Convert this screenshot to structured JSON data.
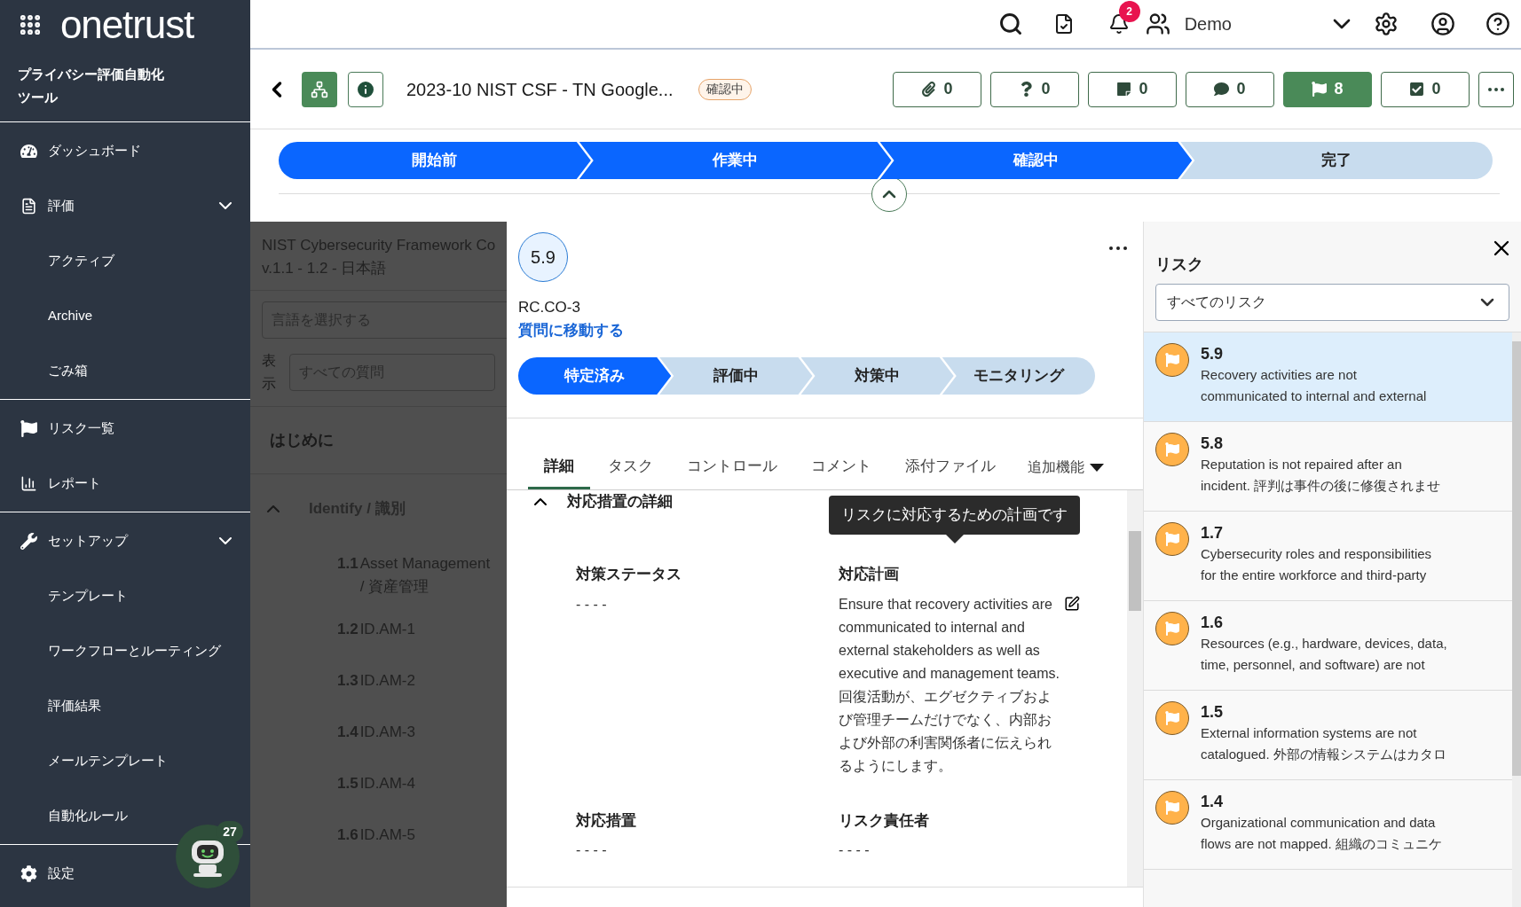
{
  "sidebar": {
    "logo": "onetrust",
    "title": "プライバシー評価自動化ツール",
    "sections": [
      {
        "items": [
          {
            "kind": "main",
            "label": "ダッシュボード"
          },
          {
            "kind": "main",
            "label": "評価",
            "expanded": true
          },
          {
            "kind": "sub",
            "label": "アクティブ"
          },
          {
            "kind": "sub",
            "label": "Archive"
          },
          {
            "kind": "sub",
            "label": "ごみ箱"
          }
        ]
      },
      {
        "items": [
          {
            "kind": "main",
            "label": "リスク一覧"
          },
          {
            "kind": "main",
            "label": "レポート"
          }
        ]
      },
      {
        "items": [
          {
            "kind": "main",
            "label": "セットアップ",
            "expanded": true
          },
          {
            "kind": "sub",
            "label": "テンプレート"
          },
          {
            "kind": "sub",
            "label": "ワークフローとルーティング"
          },
          {
            "kind": "sub",
            "label": "評価結果"
          },
          {
            "kind": "sub",
            "label": "メールテンプレート"
          },
          {
            "kind": "sub",
            "label": "自動化ルール"
          }
        ]
      },
      {
        "items": [
          {
            "kind": "main",
            "label": "設定"
          }
        ]
      }
    ],
    "bot_badge": "27"
  },
  "header": {
    "notification_count": "2",
    "user": "Demo"
  },
  "assessment": {
    "title": "2023-10 NIST CSF - TN Google...",
    "status": "確認中",
    "counters": [
      {
        "kind": "attachment",
        "count": "0",
        "selected": false
      },
      {
        "kind": "question",
        "count": "0",
        "selected": false
      },
      {
        "kind": "note",
        "count": "0",
        "selected": false
      },
      {
        "kind": "comment",
        "count": "0",
        "selected": false
      },
      {
        "kind": "risk",
        "count": "8",
        "selected": true
      },
      {
        "kind": "task",
        "count": "0",
        "selected": false
      }
    ],
    "stages": [
      {
        "label": "開始前",
        "reached": true
      },
      {
        "label": "作業中",
        "reached": true
      },
      {
        "label": "確認中",
        "reached": true
      },
      {
        "label": "完了",
        "reached": false
      }
    ]
  },
  "question_panel": {
    "title": "NIST Cybersecurity Framework Co",
    "subtitle": "v.1.1 - 1.2 - 日本語",
    "language_placeholder": "言語を選択する",
    "display_label": "表示",
    "display_filter": "すべての質問",
    "intro": "はじめに",
    "group": {
      "label": "Identify / 識別",
      "expanded": true
    },
    "questions": [
      {
        "number": "1.1",
        "label": "Asset Management / 資産管理"
      },
      {
        "number": "1.2",
        "label": "ID.AM-1"
      },
      {
        "number": "1.3",
        "label": "ID.AM-2"
      },
      {
        "number": "1.4",
        "label": "ID.AM-3"
      },
      {
        "number": "1.5",
        "label": "ID.AM-4"
      },
      {
        "number": "1.6",
        "label": "ID.AM-5"
      }
    ]
  },
  "risk_detail": {
    "score": "5.9",
    "id": "RC.CO-3",
    "link": "質問に移動する",
    "stages": [
      {
        "label": "特定済み",
        "selected": true
      },
      {
        "label": "評価中",
        "selected": false
      },
      {
        "label": "対策中",
        "selected": false
      },
      {
        "label": "モニタリング",
        "selected": false
      }
    ],
    "tabs": [
      {
        "label": "詳細",
        "selected": true
      },
      {
        "label": "タスク",
        "selected": false
      },
      {
        "label": "コントロール",
        "selected": false
      },
      {
        "label": "コメント",
        "selected": false
      },
      {
        "label": "添付ファイル",
        "selected": false
      }
    ],
    "more_tab": "追加機能",
    "section": {
      "title": "対応措置の詳細",
      "expanded": true
    },
    "tooltip": "リスクに対応するための計画です",
    "fields": [
      {
        "label": "対策ステータス",
        "paragraphs": [
          "- - - -"
        ],
        "editable": false
      },
      {
        "label": "対応計画",
        "paragraphs": [
          "Ensure that recovery activities are communicated to internal and external stakeholders as well as executive and management teams.",
          "回復活動が、エグゼクティブおよび管理チームだけでなく、内部および外部の利害関係者に伝えられるようにします。"
        ],
        "editable": true
      },
      {
        "label": "対応措置",
        "paragraphs": [
          "- - - -"
        ],
        "editable": false
      },
      {
        "label": "リスク責任者",
        "paragraphs": [
          "- - - -"
        ],
        "editable": false
      }
    ]
  },
  "risk_panel": {
    "title": "リスク",
    "filter": "すべてのリスク",
    "risks": [
      {
        "number": "5.9",
        "lines": [
          "Recovery activities are not",
          "communicated to internal and external"
        ],
        "selected": true
      },
      {
        "number": "5.8",
        "lines": [
          "Reputation is not repaired after an",
          "incident. 評判は事件の後に修復されませ"
        ],
        "selected": false
      },
      {
        "number": "1.7",
        "lines": [
          "Cybersecurity roles and responsibilities",
          "for the entire workforce and third-party"
        ],
        "selected": false
      },
      {
        "number": "1.6",
        "lines": [
          "Resources (e.g., hardware, devices, data,",
          "time, personnel, and software) are not"
        ],
        "selected": false
      },
      {
        "number": "1.5",
        "lines": [
          "External information systems are not",
          "catalogued. 外部の情報システムはカタロ"
        ],
        "selected": false
      },
      {
        "number": "1.4",
        "lines": [
          "Organizational communication and data",
          "flows are not mapped. 組織のコミュニケ"
        ],
        "selected": false
      }
    ]
  }
}
